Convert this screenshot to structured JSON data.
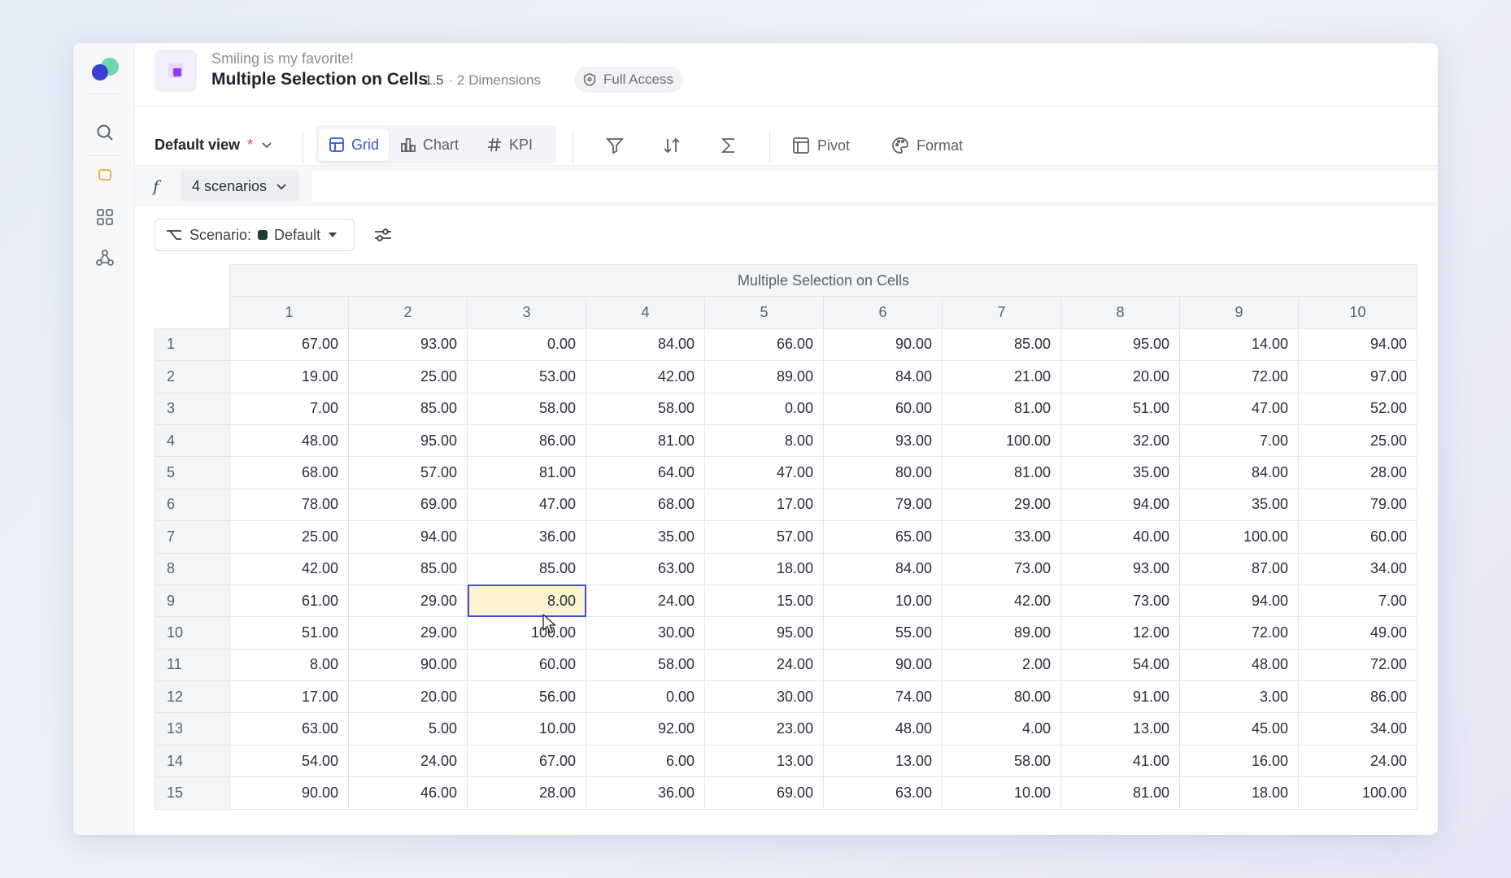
{
  "rail": {
    "icons": [
      "app-logo",
      "search-icon",
      "note-icon",
      "apps-grid-icon",
      "network-icon"
    ]
  },
  "header": {
    "subtitle": "Smiling is my favorite!",
    "title": "Multiple Selection on Cells",
    "version": "1.5",
    "dimensions": "· 2 Dimensions",
    "access": "Full Access"
  },
  "toolbar": {
    "view_label": "Default view",
    "view_modified": "*",
    "grid_label": "Grid",
    "chart_label": "Chart",
    "kpi_label": "KPI",
    "pivot_label": "Pivot",
    "format_label": "Format"
  },
  "formula_bar": {
    "fx_symbol": "f",
    "scenarios_label": "4 scenarios"
  },
  "filter": {
    "scenario_prefix": "Scenario:",
    "scenario_value": "Default",
    "scenario_color": "#1f3b2c"
  },
  "grid": {
    "title": "Multiple Selection on Cells",
    "columns": [
      "1",
      "2",
      "3",
      "4",
      "5",
      "6",
      "7",
      "8",
      "9",
      "10"
    ],
    "rows": [
      {
        "label": "1",
        "values": [
          "67.00",
          "93.00",
          "0.00",
          "84.00",
          "66.00",
          "90.00",
          "85.00",
          "95.00",
          "14.00",
          "94.00"
        ]
      },
      {
        "label": "2",
        "values": [
          "19.00",
          "25.00",
          "53.00",
          "42.00",
          "89.00",
          "84.00",
          "21.00",
          "20.00",
          "72.00",
          "97.00"
        ]
      },
      {
        "label": "3",
        "values": [
          "7.00",
          "85.00",
          "58.00",
          "58.00",
          "0.00",
          "60.00",
          "81.00",
          "51.00",
          "47.00",
          "52.00"
        ]
      },
      {
        "label": "4",
        "values": [
          "48.00",
          "95.00",
          "86.00",
          "81.00",
          "8.00",
          "93.00",
          "100.00",
          "32.00",
          "7.00",
          "25.00"
        ]
      },
      {
        "label": "5",
        "values": [
          "68.00",
          "57.00",
          "81.00",
          "64.00",
          "47.00",
          "80.00",
          "81.00",
          "35.00",
          "84.00",
          "28.00"
        ]
      },
      {
        "label": "6",
        "values": [
          "78.00",
          "69.00",
          "47.00",
          "68.00",
          "17.00",
          "79.00",
          "29.00",
          "94.00",
          "35.00",
          "79.00"
        ]
      },
      {
        "label": "7",
        "values": [
          "25.00",
          "94.00",
          "36.00",
          "35.00",
          "57.00",
          "65.00",
          "33.00",
          "40.00",
          "100.00",
          "60.00"
        ]
      },
      {
        "label": "8",
        "values": [
          "42.00",
          "85.00",
          "85.00",
          "63.00",
          "18.00",
          "84.00",
          "73.00",
          "93.00",
          "87.00",
          "34.00"
        ]
      },
      {
        "label": "9",
        "values": [
          "61.00",
          "29.00",
          "8.00",
          "24.00",
          "15.00",
          "10.00",
          "42.00",
          "73.00",
          "94.00",
          "7.00"
        ]
      },
      {
        "label": "10",
        "values": [
          "51.00",
          "29.00",
          "100.00",
          "30.00",
          "95.00",
          "55.00",
          "89.00",
          "12.00",
          "72.00",
          "49.00"
        ]
      },
      {
        "label": "11",
        "values": [
          "8.00",
          "90.00",
          "60.00",
          "58.00",
          "24.00",
          "90.00",
          "2.00",
          "54.00",
          "48.00",
          "72.00"
        ]
      },
      {
        "label": "12",
        "values": [
          "17.00",
          "20.00",
          "56.00",
          "0.00",
          "30.00",
          "74.00",
          "80.00",
          "91.00",
          "3.00",
          "86.00"
        ]
      },
      {
        "label": "13",
        "values": [
          "63.00",
          "5.00",
          "10.00",
          "92.00",
          "23.00",
          "48.00",
          "4.00",
          "13.00",
          "45.00",
          "34.00"
        ]
      },
      {
        "label": "14",
        "values": [
          "54.00",
          "24.00",
          "67.00",
          "6.00",
          "13.00",
          "13.00",
          "58.00",
          "41.00",
          "16.00",
          "24.00"
        ]
      },
      {
        "label": "15",
        "values": [
          "90.00",
          "46.00",
          "28.00",
          "36.00",
          "69.00",
          "63.00",
          "10.00",
          "81.00",
          "18.00",
          "100.00"
        ]
      }
    ],
    "selected": {
      "row": "9",
      "col": "3"
    }
  },
  "colors": {
    "accent": "#3a50d9",
    "selection_fill": "#fdf4cf",
    "selection_border": "#3d4fd6"
  }
}
